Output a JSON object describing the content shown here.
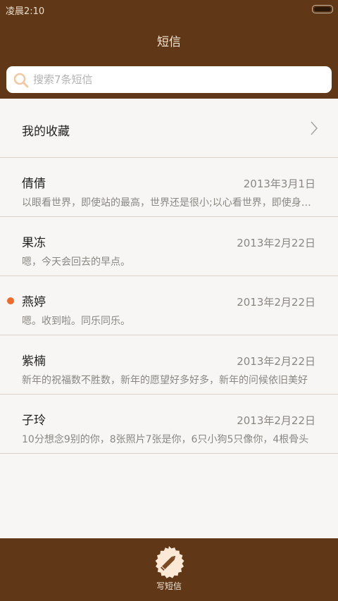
{
  "status_bar": {
    "time": "凌晨2:10"
  },
  "header": {
    "title": "短信"
  },
  "search": {
    "placeholder": "搜索7条短信"
  },
  "favorites": {
    "label": "我的收藏"
  },
  "conversations": [
    {
      "name": "倩倩",
      "date": "2013年3月1日",
      "preview": "以眼看世界，即使站的最高，世界还是很小;以心看世界，即使身处斗室，世界也很广阔",
      "unread": false
    },
    {
      "name": "果冻",
      "date": "2013年2月22日",
      "preview": "嗯，今天会回去的早点。",
      "unread": false
    },
    {
      "name": "燕婷",
      "date": "2013年2月22日",
      "preview": "嗯。收到啦。同乐同乐。",
      "unread": true
    },
    {
      "name": "紫楠",
      "date": "2013年2月22日",
      "preview": "新年的祝福数不胜数，新年的愿望好多好多，新年的问候依旧美好",
      "unread": false
    },
    {
      "name": "子玲",
      "date": "2013年2月22日",
      "preview": "10分想念9别的你，8张照片7张是你，6只小狗5只像你，4根骨头",
      "unread": false
    }
  ],
  "bottom_bar": {
    "compose_label": "写短信"
  },
  "colors": {
    "brand_brown": "#603817",
    "unread_dot": "#f06a2a",
    "compose_badge": "#fbe9d6"
  }
}
